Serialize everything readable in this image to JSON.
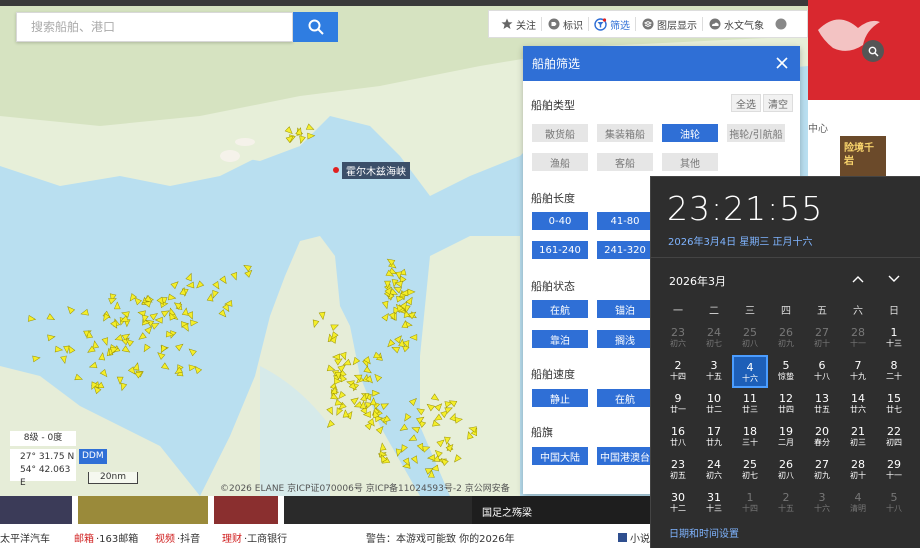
{
  "search": {
    "placeholder": "搜索船舶、港口"
  },
  "toolbar": {
    "items": [
      {
        "label": "关注",
        "icon": "star-icon"
      },
      {
        "label": "标识",
        "icon": "tag-icon"
      },
      {
        "label": "筛选",
        "icon": "filter-icon"
      },
      {
        "label": "图层显示",
        "icon": "layers-icon"
      },
      {
        "label": "水文气象",
        "icon": "weather-icon"
      }
    ]
  },
  "map": {
    "place_label": "霍尔木兹海峡",
    "zoom_text": "8级 - 0度",
    "coord_lat": "27° 31.75 N",
    "coord_lon": "54° 42.063 E",
    "coord_format": "DDM",
    "scale_label": "20nm",
    "copyright": "©2026 ELANE  京ICP证070006号  京ICP备11024593号-2  京公网安备"
  },
  "filter_panel": {
    "title": "船舶筛选",
    "all_label": "全选",
    "clear_label": "清空",
    "ship_type_title": "船舶类型",
    "ship_types": [
      "散货船",
      "集装箱船",
      "油轮",
      "拖轮/引航船",
      "渔船",
      "客船",
      "其他"
    ],
    "length_title": "船舶长度",
    "lengths": [
      "0-40",
      "41-80",
      "161-240",
      "241-320"
    ],
    "status_title": "船舶状态",
    "statuses": [
      "在航",
      "锚泊",
      "靠泊",
      "搁浅"
    ],
    "speed_title": "船舶速度",
    "speeds": [
      "静止",
      "在航"
    ],
    "flag_title": "船旗",
    "flags": [
      "中国大陆",
      "中国港澳台"
    ]
  },
  "side": {
    "text": "中心",
    "thumb_text": "险境千岩"
  },
  "clock": {
    "time": "23:21:55",
    "date_line": "2026年3月4日 星期三 正月十六",
    "month": "2026年3月",
    "weekdays": [
      "一",
      "二",
      "三",
      "四",
      "五",
      "六",
      "日"
    ],
    "footer": "日期和时间设置",
    "days": [
      {
        "n": "23",
        "l": "初六",
        "dim": true
      },
      {
        "n": "24",
        "l": "初七",
        "dim": true
      },
      {
        "n": "25",
        "l": "初八",
        "dim": true
      },
      {
        "n": "26",
        "l": "初九",
        "dim": true
      },
      {
        "n": "27",
        "l": "初十",
        "dim": true
      },
      {
        "n": "28",
        "l": "十一",
        "dim": true
      },
      {
        "n": "1",
        "l": "十三",
        "dim": false
      },
      {
        "n": "2",
        "l": "十四",
        "dim": false
      },
      {
        "n": "3",
        "l": "十五",
        "dim": false
      },
      {
        "n": "4",
        "l": "十六",
        "dim": false,
        "today": true
      },
      {
        "n": "5",
        "l": "惊蛰",
        "dim": false
      },
      {
        "n": "6",
        "l": "十八",
        "dim": false
      },
      {
        "n": "7",
        "l": "十九",
        "dim": false
      },
      {
        "n": "8",
        "l": "二十",
        "dim": false
      },
      {
        "n": "9",
        "l": "廿一",
        "dim": false
      },
      {
        "n": "10",
        "l": "廿二",
        "dim": false
      },
      {
        "n": "11",
        "l": "廿三",
        "dim": false
      },
      {
        "n": "12",
        "l": "廿四",
        "dim": false
      },
      {
        "n": "13",
        "l": "廿五",
        "dim": false
      },
      {
        "n": "14",
        "l": "廿六",
        "dim": false
      },
      {
        "n": "15",
        "l": "廿七",
        "dim": false
      },
      {
        "n": "16",
        "l": "廿八",
        "dim": false
      },
      {
        "n": "17",
        "l": "廿九",
        "dim": false
      },
      {
        "n": "18",
        "l": "三十",
        "dim": false
      },
      {
        "n": "19",
        "l": "二月",
        "dim": false
      },
      {
        "n": "20",
        "l": "春分",
        "dim": false
      },
      {
        "n": "21",
        "l": "初三",
        "dim": false
      },
      {
        "n": "22",
        "l": "初四",
        "dim": false
      },
      {
        "n": "23",
        "l": "初五",
        "dim": false
      },
      {
        "n": "24",
        "l": "初六",
        "dim": false
      },
      {
        "n": "25",
        "l": "初七",
        "dim": false
      },
      {
        "n": "26",
        "l": "初八",
        "dim": false
      },
      {
        "n": "27",
        "l": "初九",
        "dim": false
      },
      {
        "n": "28",
        "l": "初十",
        "dim": false
      },
      {
        "n": "29",
        "l": "十一",
        "dim": false
      },
      {
        "n": "30",
        "l": "十二",
        "dim": false
      },
      {
        "n": "31",
        "l": "十三",
        "dim": false
      },
      {
        "n": "1",
        "l": "十四",
        "dim": true
      },
      {
        "n": "2",
        "l": "十五",
        "dim": true
      },
      {
        "n": "3",
        "l": "十六",
        "dim": true
      },
      {
        "n": "4",
        "l": "清明",
        "dim": true
      },
      {
        "n": "5",
        "l": "十八",
        "dim": true
      }
    ]
  },
  "news": {
    "caption": "国足之殇梁",
    "items": [
      {
        "cat": "",
        "text": "太平洋汽车"
      },
      {
        "cat": "邮箱",
        "text": "·163邮箱"
      },
      {
        "cat": "视频",
        "text": "·抖音"
      },
      {
        "cat": "理财",
        "text": "·工商银行"
      }
    ],
    "notice": "警告：本游戏可能致 你的2026年",
    "tail": "小说"
  }
}
